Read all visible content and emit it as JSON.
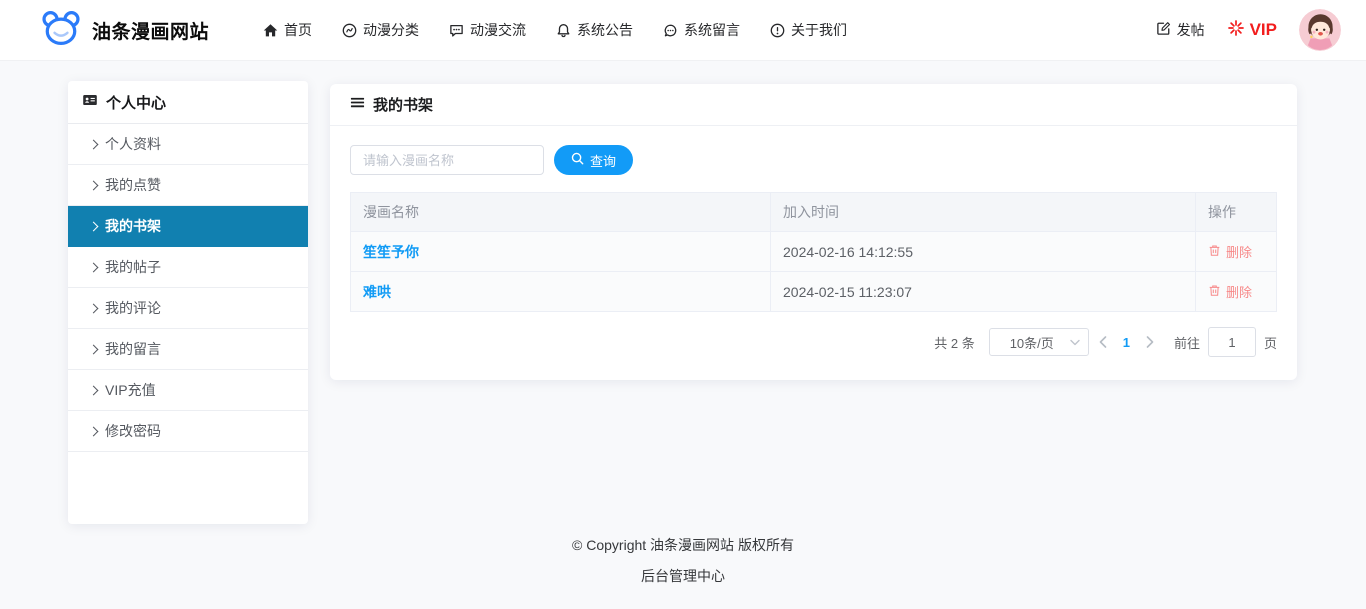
{
  "header": {
    "logo_text": "油条漫画网站",
    "logo_icon": "bear-icon",
    "nav": [
      {
        "label": "首页",
        "icon": "home-icon"
      },
      {
        "label": "动漫分类",
        "icon": "category-icon"
      },
      {
        "label": "动漫交流",
        "icon": "chat-square-icon"
      },
      {
        "label": "系统公告",
        "icon": "bell-icon"
      },
      {
        "label": "系统留言",
        "icon": "chat-round-icon"
      },
      {
        "label": "关于我们",
        "icon": "info-icon"
      }
    ],
    "post_label": "发帖",
    "post_icon": "edit-icon",
    "vip_label": "VIP",
    "vip_icon": "sparkle-icon",
    "vip_color": "#f21d1d",
    "avatar_name": "user-avatar"
  },
  "sidebar": {
    "title": "个人中心",
    "title_icon": "id-card-icon",
    "active_color": "#1180b0",
    "items": [
      {
        "label": "个人资料"
      },
      {
        "label": "我的点赞"
      },
      {
        "label": "我的书架",
        "active": true
      },
      {
        "label": "我的帖子"
      },
      {
        "label": "我的评论"
      },
      {
        "label": "我的留言"
      },
      {
        "label": "VIP充值"
      },
      {
        "label": "修改密码"
      }
    ]
  },
  "main": {
    "card_title": "我的书架",
    "card_title_icon": "menu-icon",
    "search": {
      "placeholder": "请输入漫画名称",
      "button_label": "查询",
      "button_icon": "search-icon",
      "button_color": "#129bf7"
    },
    "table": {
      "columns": [
        "漫画名称",
        "加入时间",
        "操作"
      ],
      "link_color": "#119bf5",
      "danger_color": "#f78989",
      "rows": [
        {
          "name": "笙笙予你",
          "time": "2024-02-16 14:12:55",
          "action": "删除"
        },
        {
          "name": "难哄",
          "time": "2024-02-15 11:23:07",
          "action": "删除"
        }
      ]
    },
    "pagination": {
      "total_text": "共 2 条",
      "page_size": "10条/页",
      "current_page": "1",
      "goto_prefix": "前往",
      "goto_value": "1",
      "goto_suffix": "页"
    }
  },
  "footer": {
    "copyright": "© Copyright 油条漫画网站 版权所有",
    "admin_link": "后台管理中心"
  }
}
